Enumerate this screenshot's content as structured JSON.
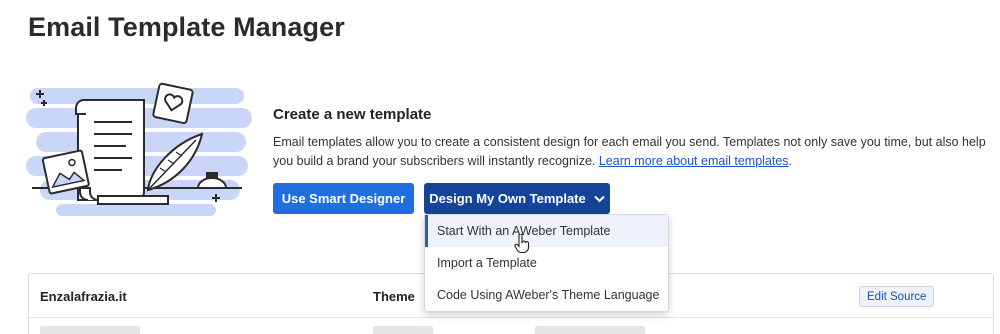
{
  "page": {
    "title": "Email Template Manager"
  },
  "intro": {
    "heading": "Create a new template",
    "body": "Email templates allow you to create a consistent design for each email you send. Templates not only save you time, but also help you build a brand your subscribers will instantly recognize. ",
    "link_text": "Learn more about email templates",
    "link_suffix": "."
  },
  "actions": {
    "smart_designer_label": "Use Smart Designer",
    "design_own_label": "Design My Own Template",
    "design_own_icon": "chevron-down-icon"
  },
  "dropdown": {
    "items": [
      {
        "label": "Start With an AWeber Template",
        "hovered": true
      },
      {
        "label": "Import a Template",
        "hovered": false
      },
      {
        "label": "Code Using AWeber's Theme Language",
        "hovered": false
      }
    ]
  },
  "table": {
    "list_name": "Enzalafrazia.it",
    "theme_header": "Theme",
    "edit_source_label": "Edit Source"
  },
  "colors": {
    "accent_light": "#1f6fe0",
    "accent_dark": "#14449a",
    "link": "#1a56c8",
    "illustration_bg": "#c9d6f7"
  }
}
